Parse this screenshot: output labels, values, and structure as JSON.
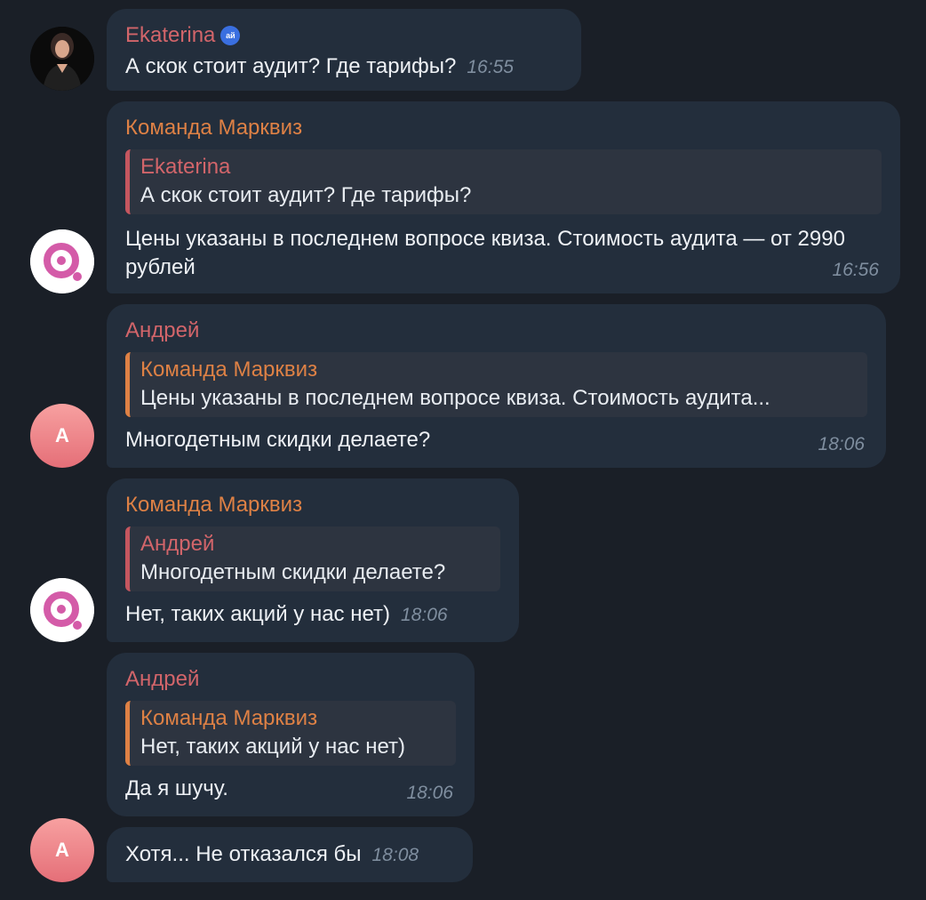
{
  "colors": {
    "background": "#1a1f27",
    "bubble": "#232e3c",
    "name_red": "#d2656a",
    "name_orange": "#de8145",
    "timestamp": "#7f8e9f"
  },
  "avatars": {
    "andrey_initial": "A"
  },
  "messages": [
    {
      "sender": "Ekaterina",
      "badge": "ай",
      "text": "А скок стоит аудит? Где тарифы?",
      "time": "16:55"
    },
    {
      "sender": "Команда Марквиз",
      "reply_name": "Ekaterina",
      "reply_text": "А скок стоит аудит? Где тарифы?",
      "text": "Цены указаны в последнем вопросе квиза. Стоимость аудита — от 2990 рублей",
      "time": "16:56"
    },
    {
      "sender": "Андрей",
      "reply_name": "Команда Марквиз",
      "reply_text": "Цены указаны в последнем вопросе квиза. Стоимость аудита...",
      "text": "Многодетным скидки делаете?",
      "time": "18:06"
    },
    {
      "sender": "Команда Марквиз",
      "reply_name": "Андрей",
      "reply_text": "Многодетным скидки делаете?",
      "text": "Нет, таких акций у нас нет)",
      "time": "18:06"
    },
    {
      "sender": "Андрей",
      "reply_name": "Команда Марквиз",
      "reply_text": "Нет, таких акций у нас нет)",
      "text": "Да я шучу.",
      "time": "18:06"
    },
    {
      "text": "Хотя... Не отказался бы",
      "time": "18:08"
    }
  ]
}
